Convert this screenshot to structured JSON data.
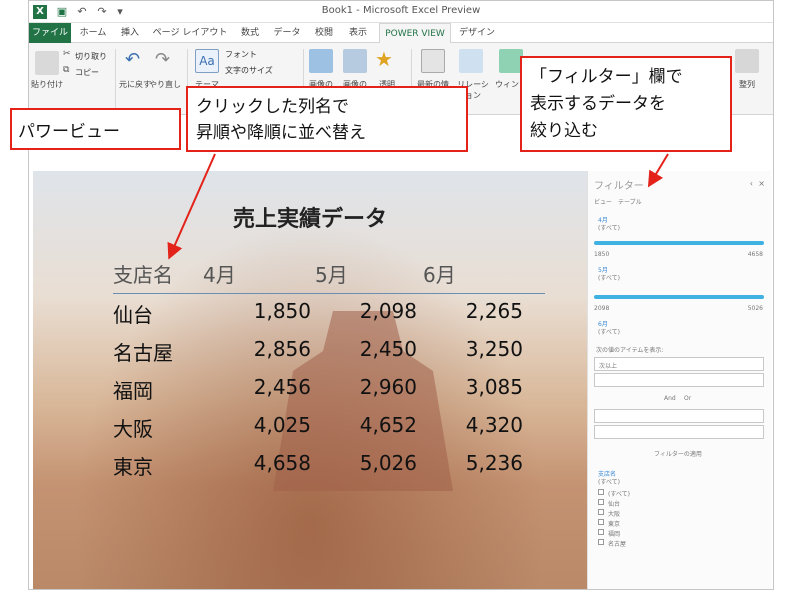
{
  "titlebar": {
    "title": "Book1 - Microsoft Excel Preview",
    "app_logo": "X"
  },
  "tabs": [
    "ファイル",
    "ホーム",
    "挿入",
    "ページ レイアウト",
    "数式",
    "データ",
    "校閲",
    "表示",
    "POWER VIEW",
    "デザイン"
  ],
  "active_tab": "POWER VIEW",
  "ribbon": {
    "paste_label": "貼り付け",
    "cut_label": "切り取り",
    "copy_label": "コピー",
    "undo_label": "元に戻す",
    "redo_label": "やり直し",
    "theme_label": "テーマ",
    "font_label": "フォント",
    "text_size_label": "文字のサイズ",
    "image_label": "画像の",
    "image_pos_label": "画像の",
    "transparency_label": "透明",
    "refresh_label": "最新の情報",
    "relationships_label": "リレーション",
    "window_label": "ウィンド",
    "arrange_label": "整列"
  },
  "report": {
    "title": "売上実績データ",
    "columns": [
      "支店名",
      "4月",
      "5月",
      "6月"
    ],
    "rows": [
      {
        "name": "仙台",
        "values": [
          "1,850",
          "2,098",
          "2,265"
        ]
      },
      {
        "name": "名古屋",
        "values": [
          "2,856",
          "2,450",
          "3,250"
        ]
      },
      {
        "name": "福岡",
        "values": [
          "2,456",
          "2,960",
          "3,085"
        ]
      },
      {
        "name": "大阪",
        "values": [
          "4,025",
          "4,652",
          "4,320"
        ]
      },
      {
        "name": "東京",
        "values": [
          "4,658",
          "5,026",
          "5,236"
        ]
      }
    ]
  },
  "filter_pane": {
    "title": "フィルター",
    "tab_view": "ビュー",
    "tab_table": "テーブル",
    "field_4": "4月",
    "field_4_sub": "(すべて)",
    "range_4_min": "1850",
    "range_4_max": "4658",
    "field_5": "5月",
    "field_5_sub": "(すべて)",
    "range_5_min": "2098",
    "range_5_max": "5026",
    "field_6": "6月",
    "field_6_sub": "(すべて)",
    "condition_label": "次の値のアイテムを表示:",
    "condition_value": "次以上",
    "and_label": "And",
    "or_label": "Or",
    "apply_label": "フィルターの適用",
    "branch_field": "支店名",
    "branch_sub": "(すべて)",
    "branch_items": [
      "(すべて)",
      "仙台",
      "大阪",
      "東京",
      "福岡",
      "名古屋"
    ]
  },
  "annotations": {
    "powerview": "パワービュー",
    "sort_line1": "クリックした列名で",
    "sort_line2": "昇順や降順に並べ替え",
    "filter_line1": "「フィルター」欄で",
    "filter_line2": "表示するデータを",
    "filter_line3": "絞り込む"
  },
  "colors": {
    "excel_green": "#217346",
    "callout_red": "#e32219",
    "filter_blue": "#3fb1e3"
  }
}
